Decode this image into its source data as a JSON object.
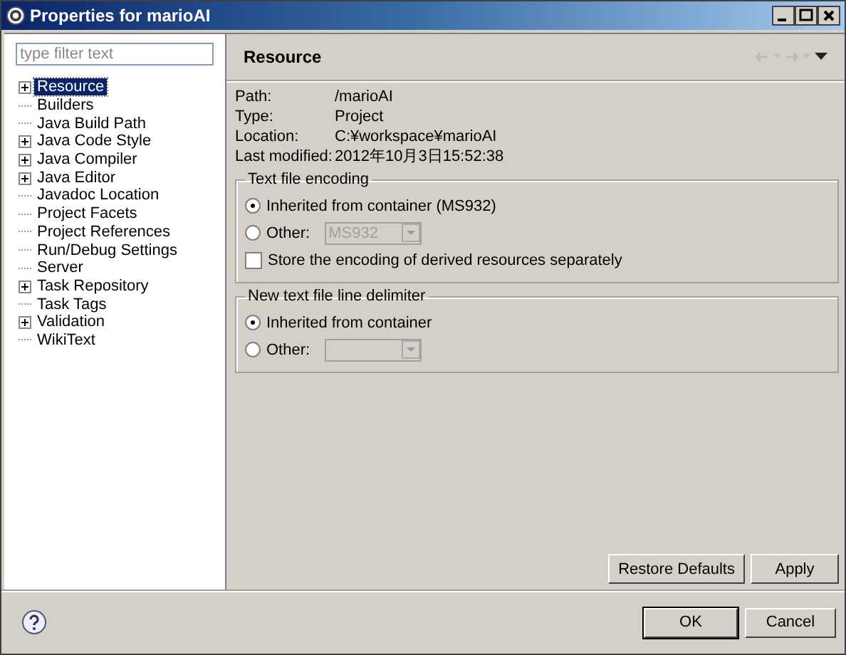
{
  "window": {
    "title": "Properties for marioAI"
  },
  "filter": {
    "placeholder": "type filter text"
  },
  "tree": [
    {
      "label": "Resource",
      "kind": "collapsed",
      "selected": true
    },
    {
      "label": "Builders",
      "kind": "leaf",
      "selected": false
    },
    {
      "label": "Java Build Path",
      "kind": "leaf",
      "selected": false
    },
    {
      "label": "Java Code Style",
      "kind": "collapsed",
      "selected": false
    },
    {
      "label": "Java Compiler",
      "kind": "collapsed",
      "selected": false
    },
    {
      "label": "Java Editor",
      "kind": "collapsed",
      "selected": false
    },
    {
      "label": "Javadoc Location",
      "kind": "leaf",
      "selected": false
    },
    {
      "label": "Project Facets",
      "kind": "leaf",
      "selected": false
    },
    {
      "label": "Project References",
      "kind": "leaf",
      "selected": false
    },
    {
      "label": "Run/Debug Settings",
      "kind": "leaf",
      "selected": false
    },
    {
      "label": "Server",
      "kind": "leaf",
      "selected": false
    },
    {
      "label": "Task Repository",
      "kind": "collapsed",
      "selected": false
    },
    {
      "label": "Task Tags",
      "kind": "leaf",
      "selected": false
    },
    {
      "label": "Validation",
      "kind": "collapsed",
      "selected": false
    },
    {
      "label": "WikiText",
      "kind": "leaf",
      "selected": false
    }
  ],
  "page": {
    "title": "Resource",
    "info": [
      {
        "label": "Path:",
        "value": "/marioAI"
      },
      {
        "label": "Type:",
        "value": "Project"
      },
      {
        "label": "Location:",
        "value": "C:¥workspace¥marioAI"
      },
      {
        "label": "Last modified:",
        "value": "2012年10月3日15:52:38"
      }
    ],
    "groups": [
      {
        "title": "Text file encoding",
        "items": [
          {
            "kind": "radio",
            "label": "Inherited from container (MS932)",
            "selected": true
          },
          {
            "kind": "radio-combo",
            "label": "Other:",
            "selected": false,
            "combo": {
              "value": "MS932",
              "disabled": true
            }
          },
          {
            "kind": "checkbox",
            "label": "Store the encoding of derived resources separately",
            "checked": false
          }
        ]
      },
      {
        "title": "New text file line delimiter",
        "items": [
          {
            "kind": "radio",
            "label": "Inherited from container",
            "selected": true
          },
          {
            "kind": "radio-combo",
            "label": "Other:",
            "selected": false,
            "combo": {
              "disabled": true
            }
          }
        ]
      }
    ],
    "buttons": [
      "Restore Defaults",
      "Apply"
    ]
  },
  "dialog_buttons": [
    {
      "label": "OK",
      "default": true
    },
    {
      "label": "Cancel",
      "default": false
    }
  ]
}
